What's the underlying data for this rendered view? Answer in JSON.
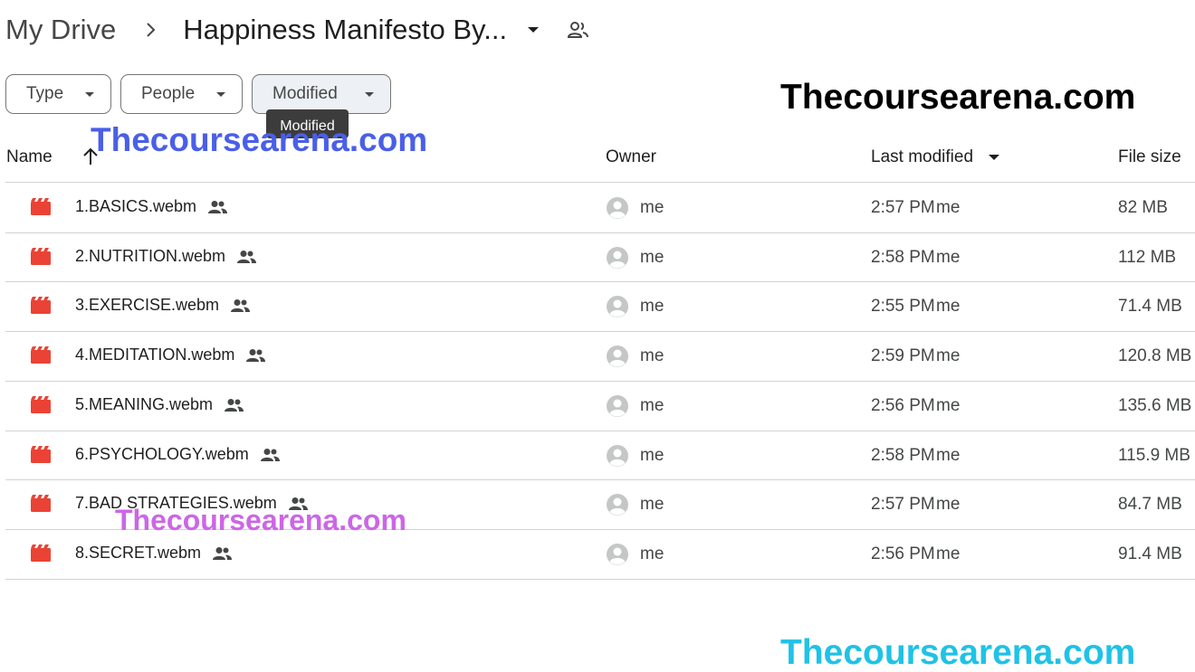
{
  "breadcrumb": {
    "root": "My Drive",
    "current": "Happiness Manifesto By...",
    "separator_icon": "chevron-right-icon",
    "caret_icon": "caret-down-icon",
    "shared_icon": "shared-folder-icon"
  },
  "filters": [
    {
      "label": "Type"
    },
    {
      "label": "People"
    },
    {
      "label": "Modified",
      "active": true
    }
  ],
  "tooltip": "Modified",
  "watermarks": [
    "Thecoursearena.com",
    "Thecoursearena.com",
    "Thecoursearena.com",
    "Thecoursearena.com"
  ],
  "table": {
    "columns": {
      "name": "Name",
      "owner": "Owner",
      "last_modified": "Last modified",
      "file_size": "File size"
    },
    "sort": {
      "column": "name",
      "direction": "ascending"
    },
    "rows": [
      {
        "name": "1.BASICS.webm",
        "owner": "me",
        "modified": "2:57 PM",
        "modified_by": "me",
        "size": "82 MB"
      },
      {
        "name": "2.NUTRITION.webm",
        "owner": "me",
        "modified": "2:58 PM",
        "modified_by": "me",
        "size": "112 MB"
      },
      {
        "name": "3.EXERCISE.webm",
        "owner": "me",
        "modified": "2:55 PM",
        "modified_by": "me",
        "size": "71.4 MB"
      },
      {
        "name": "4.MEDITATION.webm",
        "owner": "me",
        "modified": "2:59 PM",
        "modified_by": "me",
        "size": "120.8 MB"
      },
      {
        "name": "5.MEANING.webm",
        "owner": "me",
        "modified": "2:56 PM",
        "modified_by": "me",
        "size": "135.6 MB"
      },
      {
        "name": "6.PSYCHOLOGY.webm",
        "owner": "me",
        "modified": "2:58 PM",
        "modified_by": "me",
        "size": "115.9 MB"
      },
      {
        "name": "7.BAD STRATEGIES.webm",
        "owner": "me",
        "modified": "2:57 PM",
        "modified_by": "me",
        "size": "84.7 MB"
      },
      {
        "name": "8.SECRET.webm",
        "owner": "me",
        "modified": "2:56 PM",
        "modified_by": "me",
        "size": "91.4 MB"
      }
    ]
  },
  "colors": {
    "video_icon": "#ea4335",
    "watermark_black": "#000000",
    "watermark_blue": "#4a5fe8",
    "watermark_purple": "#cc66e6",
    "watermark_cyan": "#1fc2e6"
  }
}
